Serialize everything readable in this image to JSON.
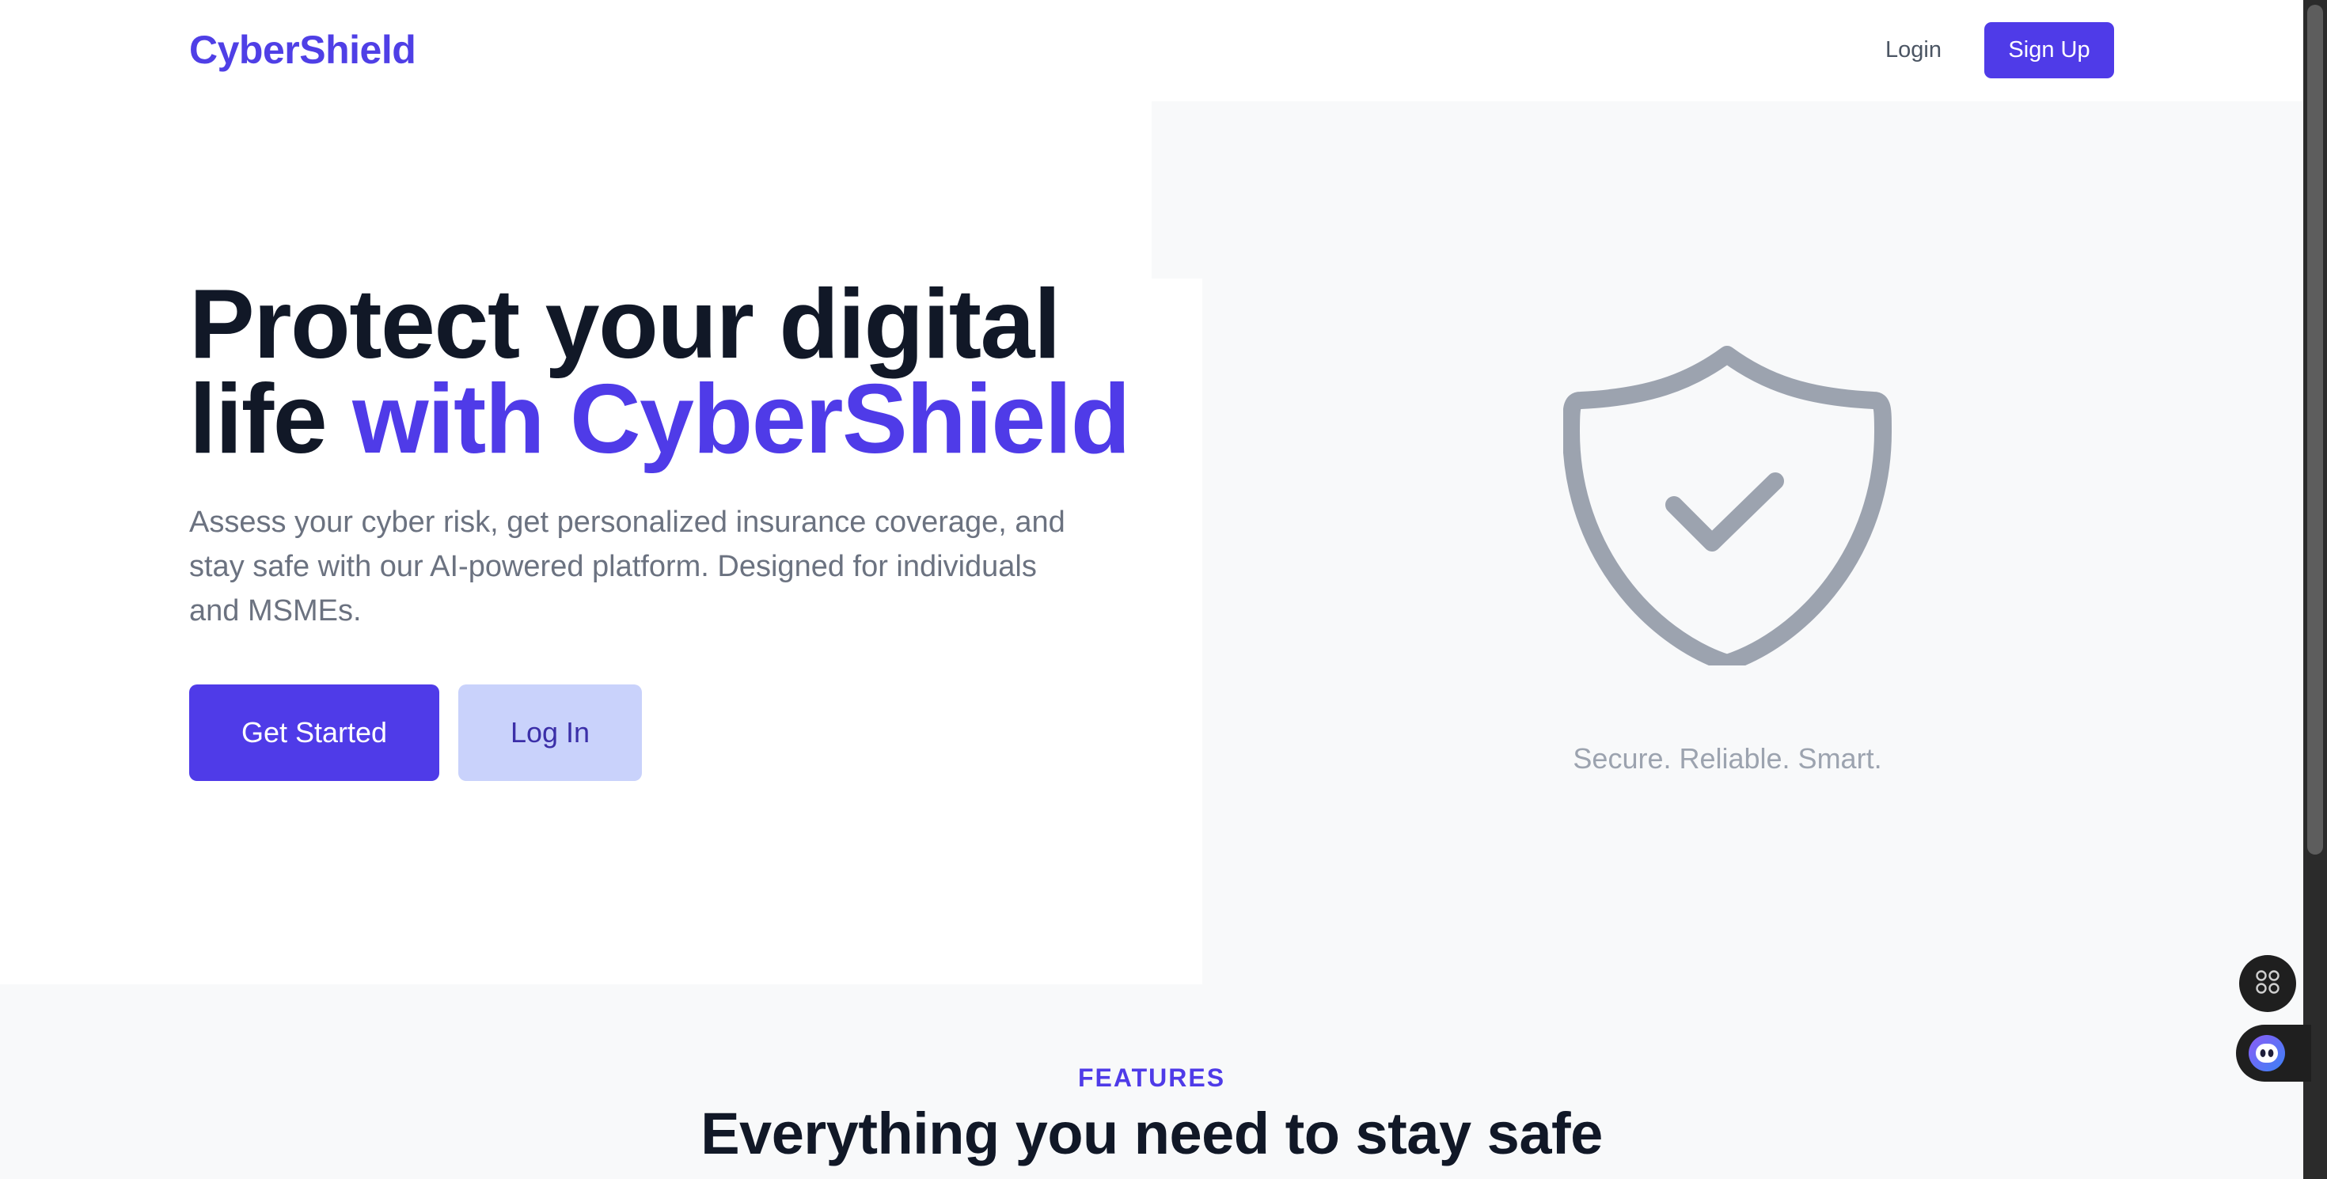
{
  "nav": {
    "logo": "CyberShield",
    "login_label": "Login",
    "signup_label": "Sign Up"
  },
  "hero": {
    "headline_part1": "Protect your digital life ",
    "headline_accent": "with CyberShield",
    "subtext": "Assess your cyber risk, get personalized insurance coverage, and stay safe with our AI-powered platform. Designed for individuals and MSMEs.",
    "primary_cta": "Get Started",
    "secondary_cta": "Log In",
    "illustration_icon": "shield-check-icon",
    "tagline": "Secure. Reliable. Smart."
  },
  "features": {
    "eyebrow": "FEATURES",
    "title": "Everything you need to stay safe"
  },
  "floating": {
    "grid_icon": "command-grid-icon",
    "assistant_icon": "assistant-face-icon"
  },
  "colors": {
    "brand": "#4f3be8",
    "brand_light": "#c9d2fb",
    "heading": "#111827",
    "body_text": "#6b7280",
    "muted": "#9ca3af",
    "panel_bg": "#f8f9fa"
  }
}
